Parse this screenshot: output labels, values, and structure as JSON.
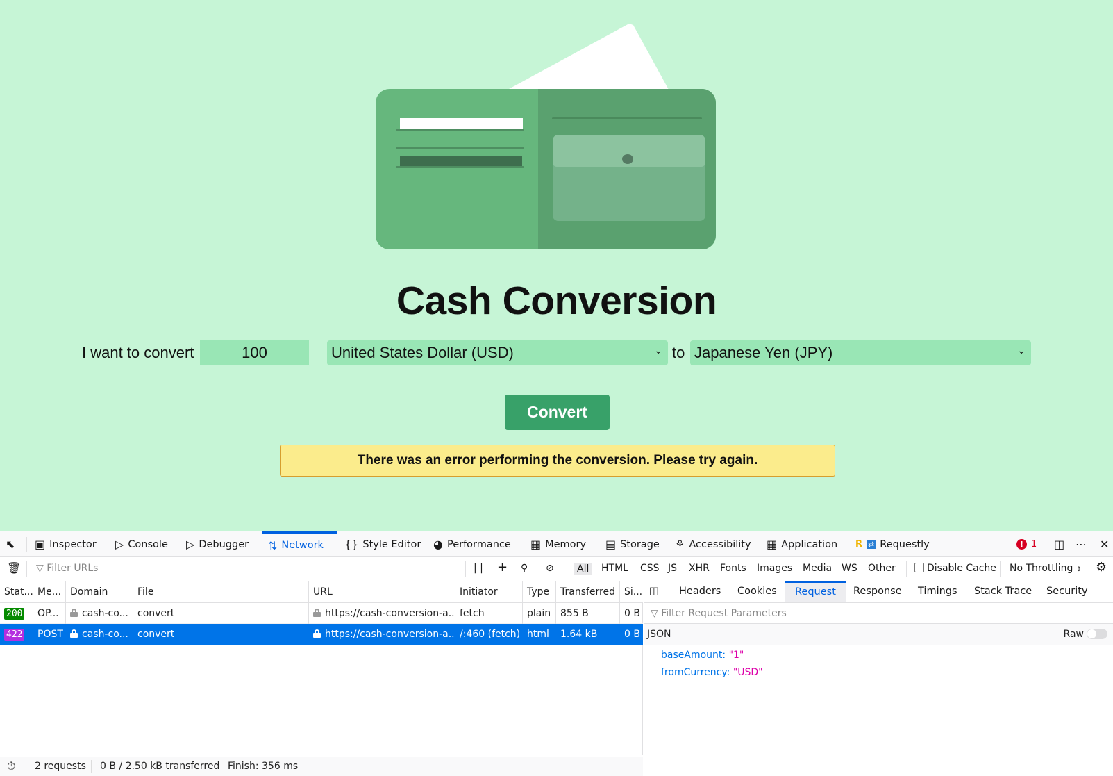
{
  "page": {
    "title": "Cash Conversion",
    "form": {
      "prefix_label": "I want to convert",
      "amount_value": "100",
      "from_currency": "United States Dollar (USD)",
      "to_label": "to",
      "to_currency": "Japanese Yen (JPY)"
    },
    "convert_label": "Convert",
    "error_message": "There was an error performing the conversion. Please try again."
  },
  "devtools": {
    "tabs": [
      {
        "label": "Inspector",
        "icon": "inspector-icon"
      },
      {
        "label": "Console",
        "icon": "console-icon"
      },
      {
        "label": "Debugger",
        "icon": "debugger-icon"
      },
      {
        "label": "Network",
        "icon": "network-icon",
        "active": true
      },
      {
        "label": "Style Editor",
        "icon": "braces-icon"
      },
      {
        "label": "Performance",
        "icon": "gauge-icon"
      },
      {
        "label": "Memory",
        "icon": "memory-icon"
      },
      {
        "label": "Storage",
        "icon": "storage-icon"
      },
      {
        "label": "Accessibility",
        "icon": "accessibility-icon"
      },
      {
        "label": "Application",
        "icon": "grid-icon"
      },
      {
        "label": "Requestly",
        "icon": "requestly-icon"
      }
    ],
    "error_count": "1",
    "filter": {
      "placeholder": "Filter URLs",
      "types": [
        "All",
        "HTML",
        "CSS",
        "JS",
        "XHR",
        "Fonts",
        "Images",
        "Media",
        "WS",
        "Other"
      ],
      "active_type": "All",
      "disable_cache_label": "Disable Cache",
      "disable_cache_checked": false,
      "throttling": "No Throttling"
    },
    "columns": [
      "Stat...",
      "Me...",
      "Domain",
      "File",
      "URL",
      "Initiator",
      "Type",
      "Transferred",
      "Si..."
    ],
    "requests": [
      {
        "status": "200",
        "status_color": "#058b00",
        "method": "OP...",
        "domain": "cash-co...",
        "file": "convert",
        "url": "https://cash-conversion-a...",
        "initiator": "fetch",
        "type": "plain",
        "transferred": "855 B",
        "size": "0 B",
        "selected": false
      },
      {
        "status": "422",
        "status_color": "#b42fe0",
        "method": "POST",
        "domain": "cash-co...",
        "file": "convert",
        "url": "https://cash-conversion-a...",
        "initiator_link": "/:460",
        "initiator": "(fetch)",
        "type": "html",
        "transferred": "1.64 kB",
        "size": "0 B",
        "selected": true
      }
    ],
    "summary": {
      "requests": "2 requests",
      "transferred": "0 B / 2.50 kB transferred",
      "finish": "Finish: 356 ms"
    },
    "detail_tabs": [
      "Headers",
      "Cookies",
      "Request",
      "Response",
      "Timings",
      "Stack Trace",
      "Security"
    ],
    "active_detail_tab": "Request",
    "request_filter_placeholder": "Filter Request Parameters",
    "json_label": "JSON",
    "raw_label": "Raw",
    "params": [
      {
        "key": "baseAmount",
        "value": "\"1\""
      },
      {
        "key": "fromCurrency",
        "value": "\"USD\""
      }
    ]
  },
  "colors": {
    "page_bg": "#c6f5d6",
    "accent_button": "#38a169",
    "error_bg": "#fbec8c",
    "devtools_active": "#0061e0",
    "row_selected": "#0074e8"
  }
}
